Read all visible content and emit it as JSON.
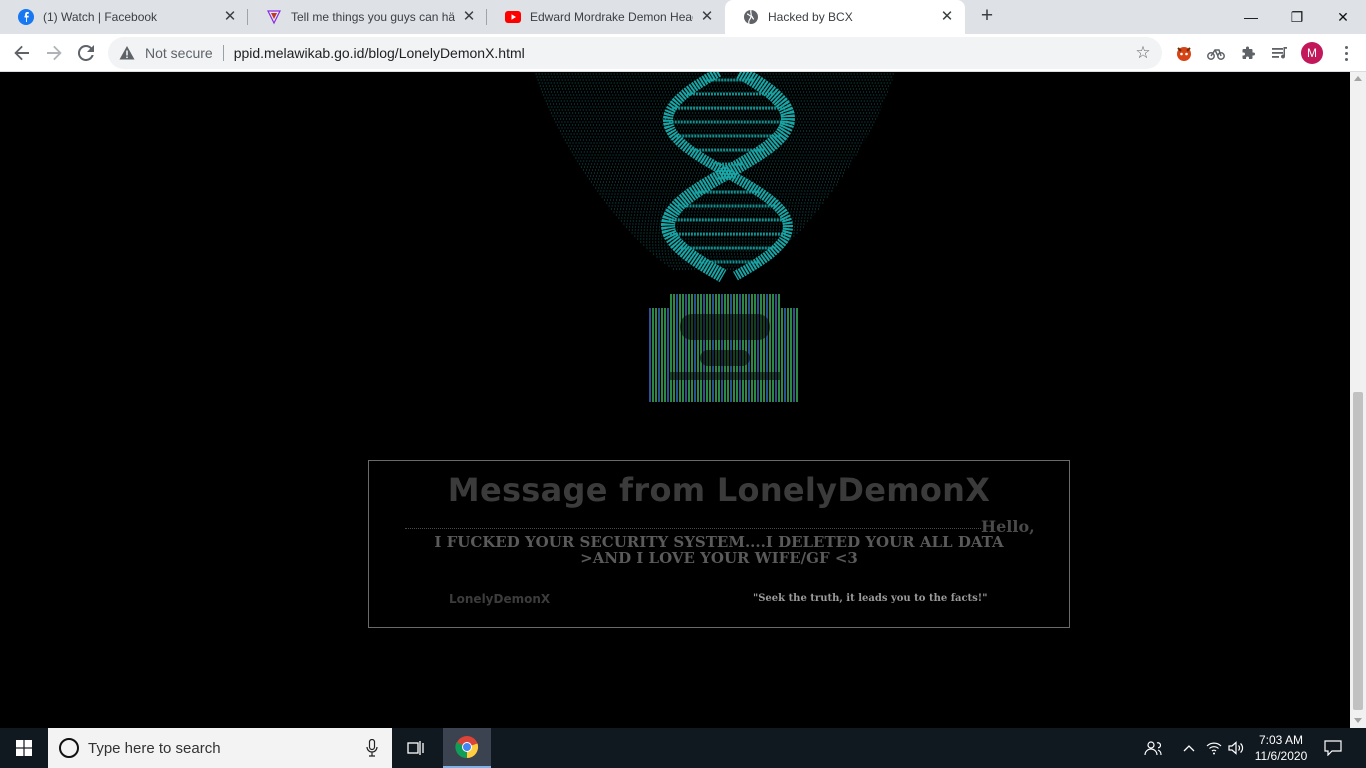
{
  "browser": {
    "tabs": [
      {
        "title": "(1) Watch | Facebook",
        "icon": "facebook-icon",
        "active": false
      },
      {
        "title": "Tell me things you guys can häck",
        "icon": "reddit-like-icon",
        "active": false
      },
      {
        "title": "Edward Mordrake Demon Head S",
        "icon": "youtube-icon",
        "active": false
      },
      {
        "title": "Hacked by BCX",
        "icon": "globe-icon",
        "active": true
      }
    ],
    "close_glyph": "✕",
    "new_tab_glyph": "+",
    "window_controls": {
      "minimize": "—",
      "maximize": "❐",
      "close": "✕"
    },
    "security_label": "Not secure",
    "url": "ppid.melawikab.go.id/blog/LonelyDemonX.html",
    "profile_initial": "M",
    "accent_color": "#1a73e8"
  },
  "page": {
    "message_title": "Message from LonelyDemonX",
    "hello": "Hello,",
    "body_line1": "I FUCKED YOUR SECURITY SYSTEM....I DELETED YOUR ALL DATA",
    "body_line2": ">AND I LOVE YOUR WIFE/GF <3",
    "author": "LonelyDemonX",
    "quote": "\"Seek the truth, it leads you to the facts!\"",
    "art_colors": {
      "dna": "#1aa6a6",
      "badge_green": "#3fbf5f",
      "badge_blue": "#3f6fcf"
    }
  },
  "taskbar": {
    "search_placeholder": "Type here to search",
    "time": "7:03 AM",
    "date": "11/6/2020"
  }
}
